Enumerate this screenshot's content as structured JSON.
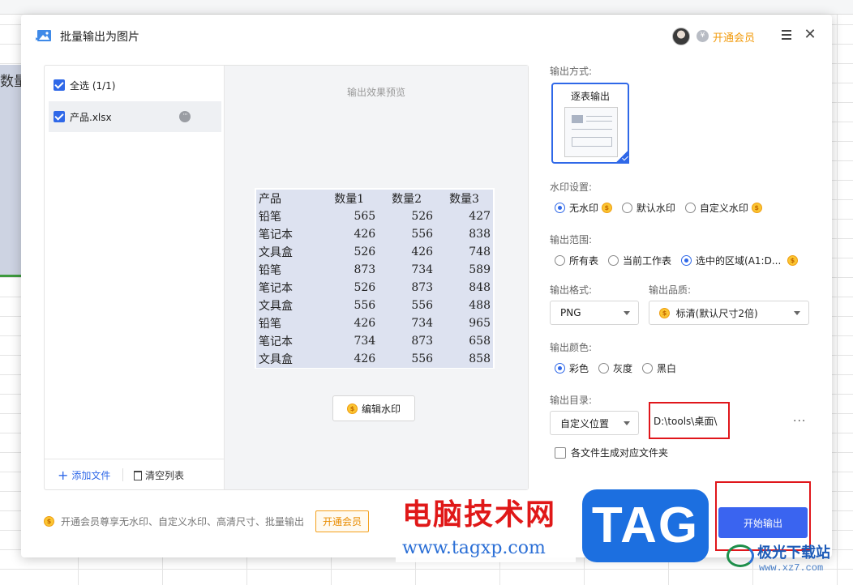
{
  "dialog": {
    "title": "批量输出为图片",
    "vip_link": "开通会员",
    "close_glyph": "✕"
  },
  "files": {
    "select_all": "全选 (1/1)",
    "items": [
      {
        "name": "产品.xlsx"
      }
    ],
    "add_file": "添加文件",
    "clear_list": "清空列表"
  },
  "preview": {
    "caption": "输出效果预览",
    "table": {
      "headers": [
        "产品",
        "数量1",
        "数量2",
        "数量3"
      ],
      "rows": [
        [
          "铅笔",
          "565",
          "526",
          "427"
        ],
        [
          "笔记本",
          "426",
          "556",
          "838"
        ],
        [
          "文具盒",
          "526",
          "426",
          "748"
        ],
        [
          "铅笔",
          "873",
          "734",
          "589"
        ],
        [
          "笔记本",
          "526",
          "873",
          "848"
        ],
        [
          "文具盒",
          "556",
          "556",
          "488"
        ],
        [
          "铅笔",
          "426",
          "734",
          "965"
        ],
        [
          "笔记本",
          "734",
          "873",
          "658"
        ],
        [
          "文具盒",
          "426",
          "556",
          "858"
        ]
      ]
    },
    "edit_watermark": "编辑水印"
  },
  "settings": {
    "mode_label": "输出方式:",
    "mode_card": "逐表输出",
    "watermark_label": "水印设置:",
    "watermark_options": [
      "无水印",
      "默认水印",
      "自定义水印"
    ],
    "watermark_selected": 0,
    "range_label": "输出范围:",
    "range_options": [
      "所有表",
      "当前工作表",
      "选中的区域(A1:D..."
    ],
    "range_selected": 2,
    "format_label": "输出格式:",
    "format_value": "PNG",
    "quality_label": "输出品质:",
    "quality_value": "标清(默认尺寸2倍)",
    "color_label": "输出颜色:",
    "color_options": [
      "彩色",
      "灰度",
      "黑白"
    ],
    "color_selected": 0,
    "dir_label": "输出目录:",
    "dir_select": "自定义位置",
    "dir_path": "D:\\tools\\桌面\\",
    "dir_more": "···",
    "subfolder_option": "各文件生成对应文件夹",
    "start_button": "开始输出"
  },
  "promo": {
    "text": "开通会员尊享无水印、自定义水印、高清尺寸、批量输出",
    "button": "开通会员"
  },
  "background": {
    "sheet_fragment": "数量"
  },
  "overlay": {
    "site_name": "电脑技术网",
    "site_url": "www.tagxp.com",
    "tag": "TAG",
    "logo_name": "极光下载站",
    "logo_url": "www.xz7.com"
  },
  "colors": {
    "accent": "#2f68e8",
    "vip": "#f29b0c",
    "highlight_frame": "#e0161b",
    "preview_fill": "#dde2f0"
  }
}
